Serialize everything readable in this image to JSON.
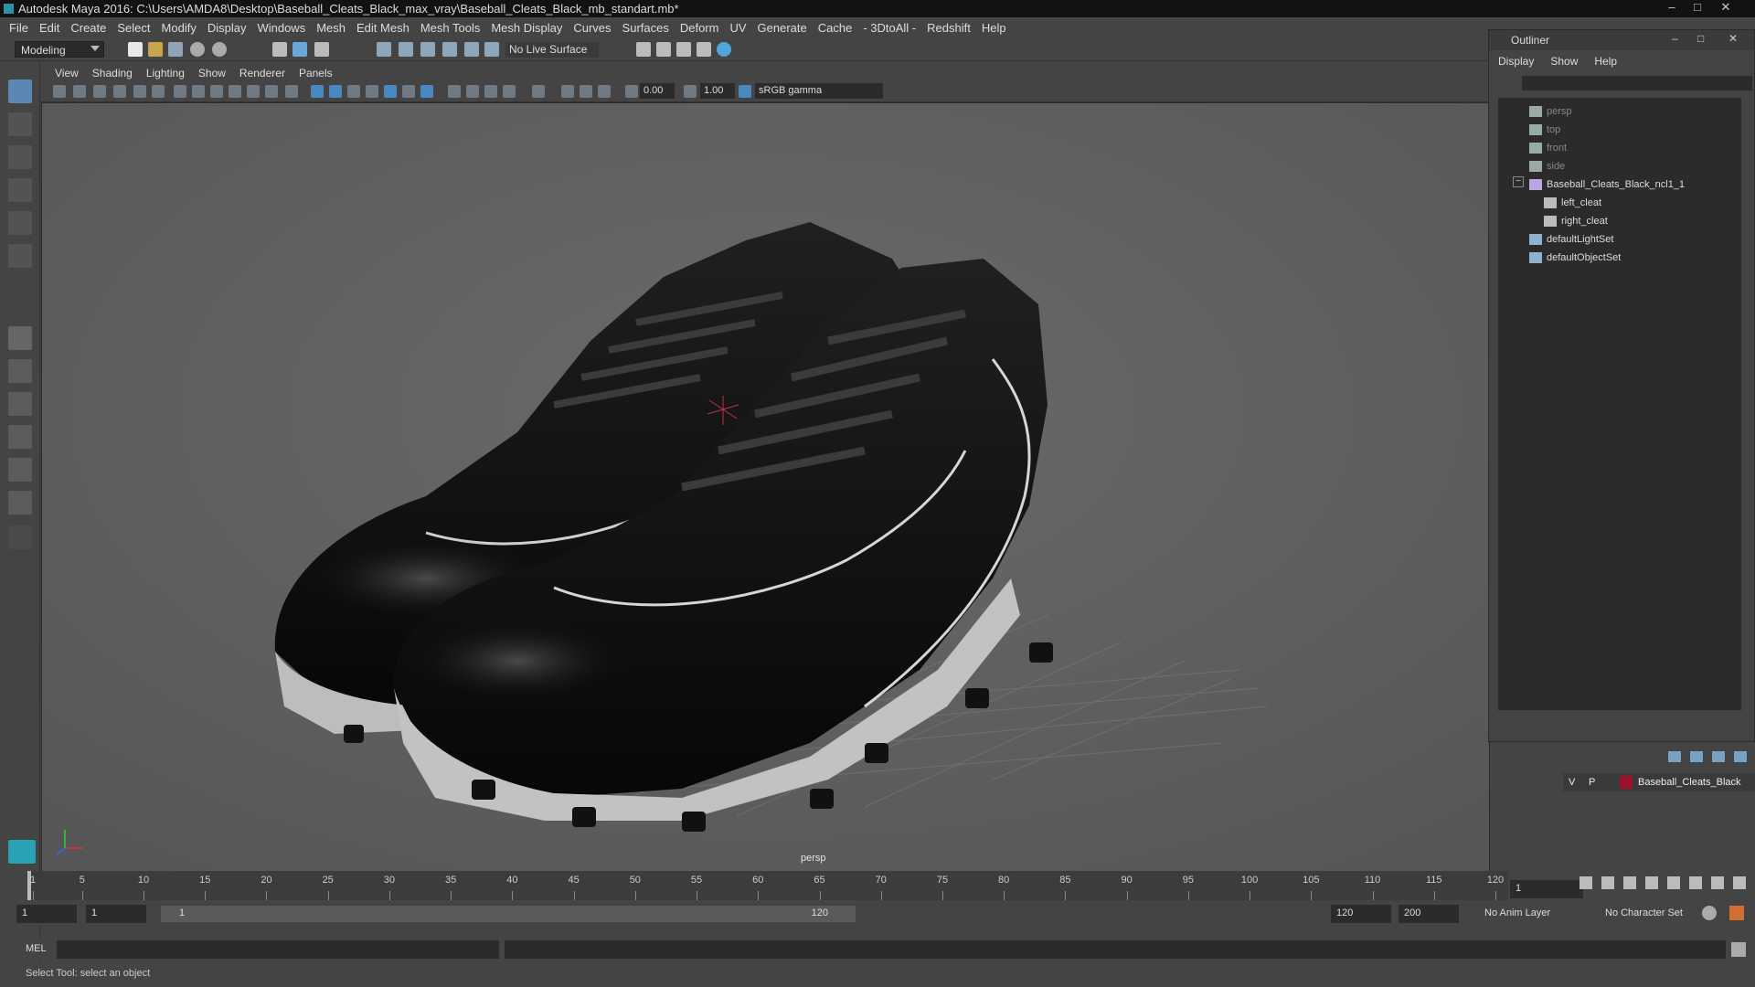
{
  "window": {
    "title": "Autodesk Maya 2016: C:\\Users\\AMDA8\\Desktop\\Baseball_Cleats_Black_max_vray\\Baseball_Cleats_Black_mb_standart.mb*",
    "minimize": "–",
    "maximize": "□",
    "close": "✕"
  },
  "menubar": [
    "File",
    "Edit",
    "Create",
    "Select",
    "Modify",
    "Display",
    "Windows",
    "Mesh",
    "Edit Mesh",
    "Mesh Tools",
    "Mesh Display",
    "Curves",
    "Surfaces",
    "Deform",
    "UV",
    "Generate",
    "Cache",
    "- 3DtoAll -",
    "Redshift",
    "Help"
  ],
  "statusline": {
    "mode": "Modeling",
    "live_surface": "No Live Surface"
  },
  "panel_menu": [
    "View",
    "Shading",
    "Lighting",
    "Show",
    "Renderer",
    "Panels"
  ],
  "panel_toolbar": {
    "exposure": "0.00",
    "gamma_value": "1.00",
    "color_space": "sRGB gamma"
  },
  "viewport": {
    "camera": "persp"
  },
  "outliner": {
    "title": "Outliner",
    "menu": [
      "Display",
      "Show",
      "Help"
    ],
    "items": [
      {
        "label": "persp",
        "type": "camera",
        "dim": true
      },
      {
        "label": "top",
        "type": "camera",
        "dim": true
      },
      {
        "label": "front",
        "type": "camera",
        "dim": true
      },
      {
        "label": "side",
        "type": "camera",
        "dim": true
      },
      {
        "label": "Baseball_Cleats_Black_ncl1_1",
        "type": "group",
        "dim": false
      },
      {
        "label": "left_cleat",
        "type": "mesh",
        "dim": false
      },
      {
        "label": "right_cleat",
        "type": "mesh",
        "dim": false
      },
      {
        "label": "defaultLightSet",
        "type": "set",
        "dim": false
      },
      {
        "label": "defaultObjectSet",
        "type": "set",
        "dim": false
      }
    ]
  },
  "layers": {
    "visible": "V",
    "playback": "P",
    "name": "Baseball_Cleats_Black",
    "color": "#a0102a"
  },
  "timeline": {
    "ticks": [
      1,
      5,
      10,
      15,
      20,
      25,
      30,
      35,
      40,
      45,
      50,
      55,
      60,
      65,
      70,
      75,
      80,
      85,
      90,
      95,
      100,
      105,
      110,
      115,
      120
    ],
    "current_frame": "1"
  },
  "range": {
    "start": "1",
    "playback_start": "1",
    "range_start_label": "1",
    "range_end_label": "120",
    "playback_end": "120",
    "end": "200",
    "anim_layer": "No Anim Layer",
    "character_set": "No Character Set"
  },
  "cmdline": {
    "label": "MEL"
  },
  "helpline": {
    "text": "Select Tool: select an object"
  }
}
